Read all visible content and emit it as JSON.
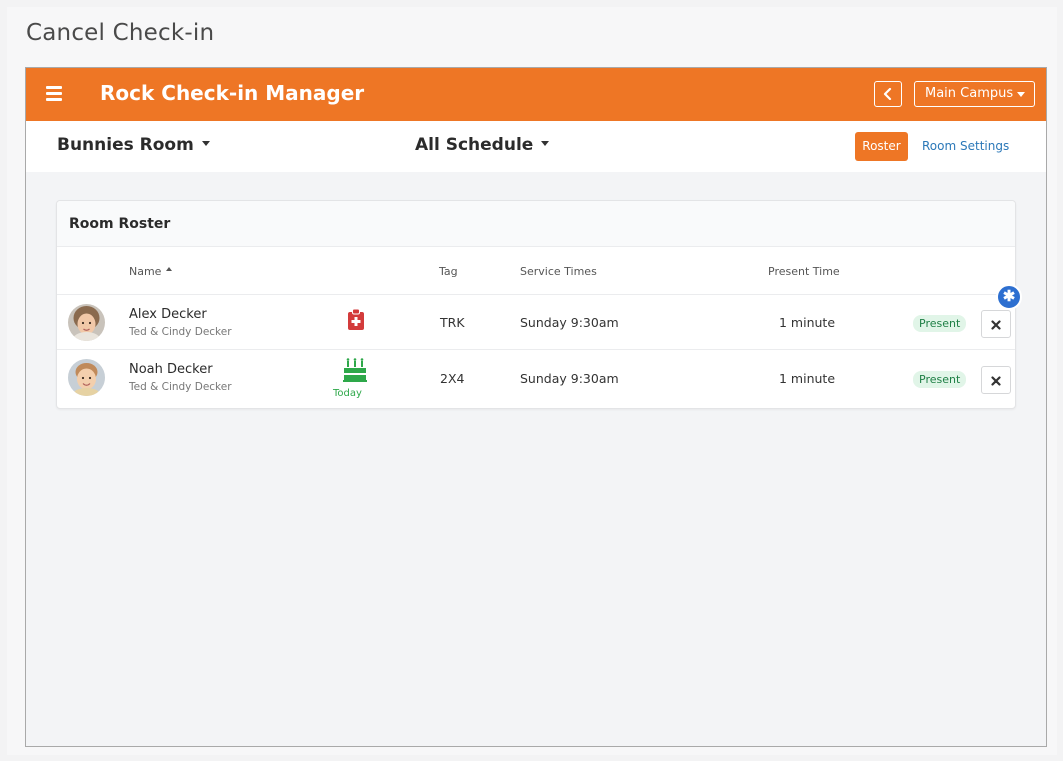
{
  "caption": "Cancel Check-in",
  "app": {
    "title": "Rock Check-in Manager"
  },
  "header": {
    "campus": "Main Campus"
  },
  "subbar": {
    "room": "Bunnies Room",
    "schedule": "All Schedule",
    "roster_label": "Roster",
    "settings_label": "Room Settings"
  },
  "panel": {
    "title": "Room Roster",
    "columns": {
      "name": "Name",
      "tag": "Tag",
      "service_times": "Service Times",
      "present_time": "Present Time"
    },
    "rows": [
      {
        "name": "Alex Decker",
        "parents": "Ted & Cindy Decker",
        "icon": "medical-clipboard-icon",
        "tag": "TRK",
        "service": "Sunday 9:30am",
        "present_time": "1 minute",
        "status": "Present"
      },
      {
        "name": "Noah Decker",
        "parents": "Ted & Cindy Decker",
        "icon": "birthday-cake-icon",
        "icon_label": "Today",
        "tag": "2X4",
        "service": "Sunday 9:30am",
        "present_time": "1 minute",
        "status": "Present"
      }
    ]
  },
  "colors": {
    "brand": "#ee7625",
    "link": "#2b78b8",
    "present_bg": "#e1f5e8",
    "present_text": "#1e7f45",
    "medical": "#d33b3b",
    "birthday": "#2ea84a",
    "marker": "#2d6fd0"
  }
}
